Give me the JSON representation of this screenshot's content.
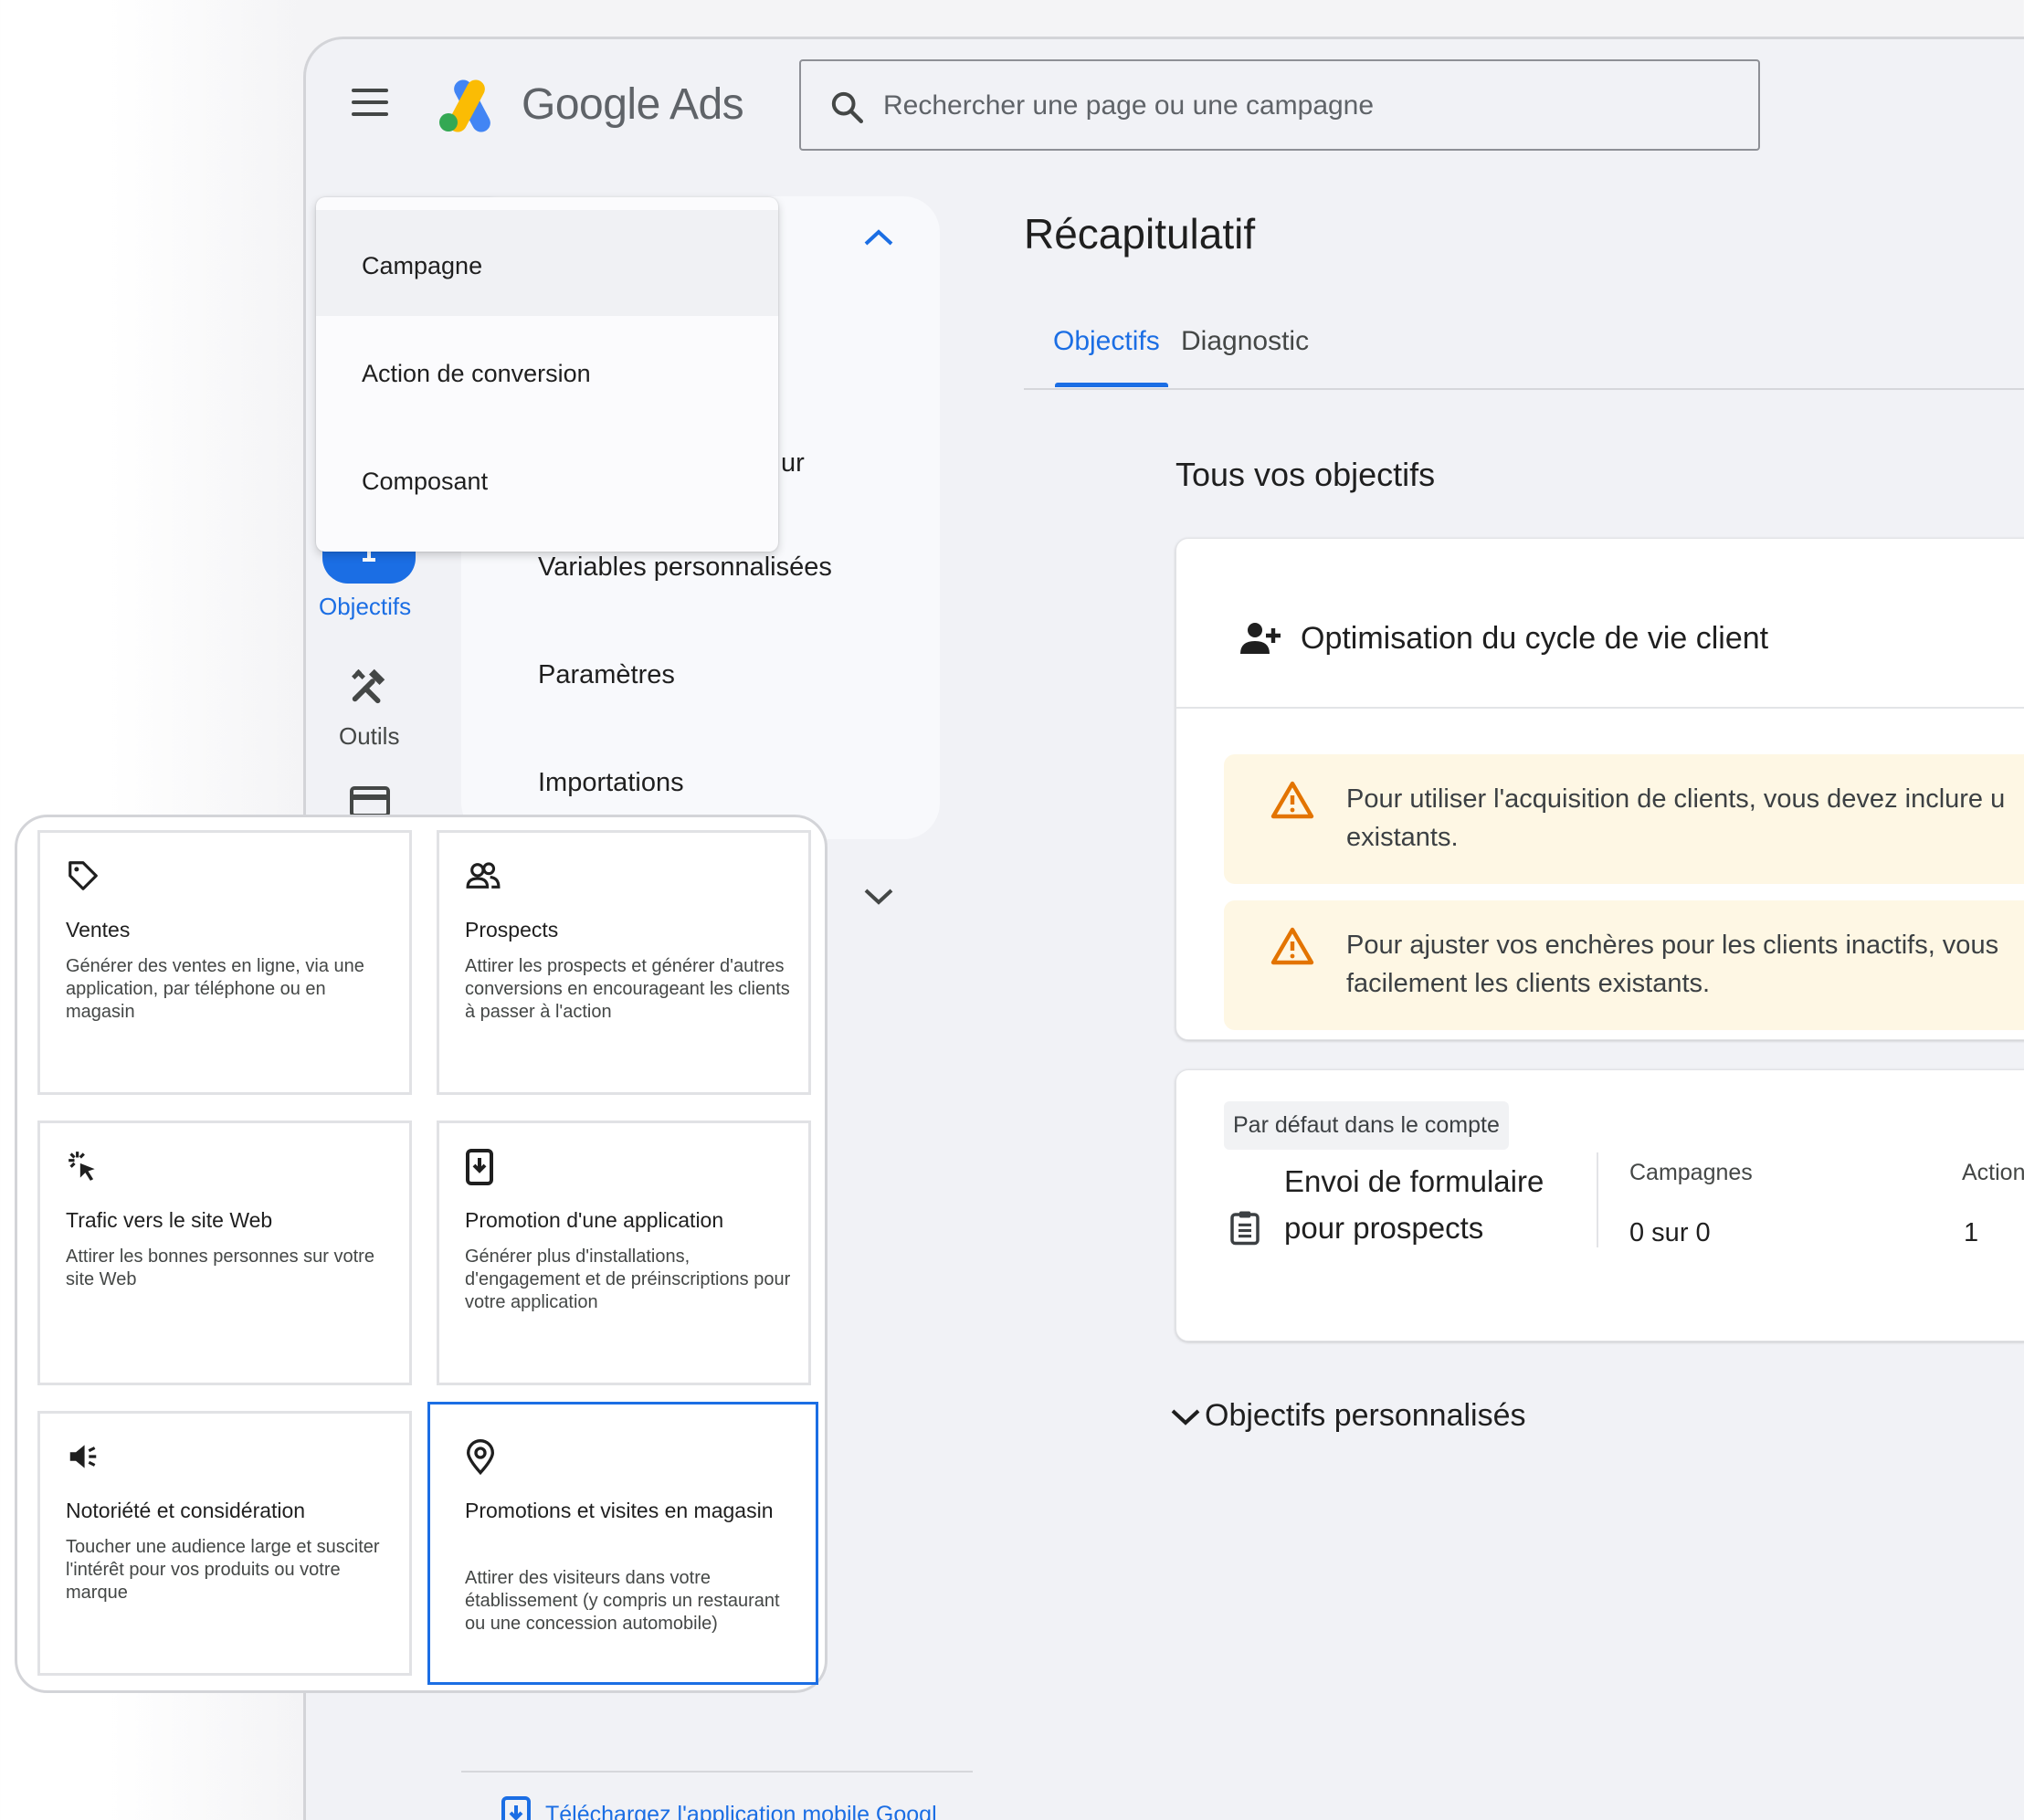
{
  "header": {
    "brand": "Google Ads",
    "search_placeholder": "Rechercher une page ou une campagne"
  },
  "create_menu": {
    "items": [
      {
        "label": "Campagne"
      },
      {
        "label": "Action de conversion"
      },
      {
        "label": "Composant"
      }
    ]
  },
  "nav": {
    "partial_label": "ur",
    "links": [
      {
        "label": "Variables personnalisées"
      },
      {
        "label": "Paramètres"
      },
      {
        "label": "Importations"
      }
    ]
  },
  "rail": {
    "goals_label": "Objectifs",
    "tools_label": "Outils"
  },
  "main": {
    "title": "Récapitulatif",
    "tabs": [
      {
        "label": "Objectifs",
        "active": true
      },
      {
        "label": "Diagnostic",
        "active": false
      }
    ],
    "section_heading": "Tous vos objectifs",
    "lifecycle": {
      "title": "Optimisation du cycle de vie client",
      "warnings": [
        {
          "line1": "Pour utiliser l'acquisition de clients, vous devez inclure u",
          "line2": "existants."
        },
        {
          "line1": "Pour ajuster vos enchères pour les clients inactifs, vous",
          "line2": "facilement les clients existants."
        }
      ]
    },
    "default_goal": {
      "chip": "Par défaut dans le compte",
      "name": "Envoi de formulaire pour prospects",
      "campaigns_header": "Campagnes",
      "campaigns_value": "0 sur 0",
      "actions_header": "Action",
      "actions_value": "1"
    },
    "custom_goals": "Objectifs personnalisés"
  },
  "footer": {
    "link": "Téléchargez l'application mobile Googl"
  },
  "goal_categories": [
    {
      "icon": "tag-icon",
      "title": "Ventes",
      "desc": "Générer des ventes en ligne, via une application, par téléphone ou en magasin"
    },
    {
      "icon": "people-icon",
      "title": "Prospects",
      "desc": "Attirer les prospects et générer d'autres conversions en encourageant les clients à passer à l'action"
    },
    {
      "icon": "cursor-click-icon",
      "title": "Trafic vers le site Web",
      "desc": "Attirer les bonnes personnes sur votre site Web"
    },
    {
      "icon": "phone-download-icon",
      "title": "Promotion d'une application",
      "desc": "Générer plus d'installations, d'engagement et de préinscriptions pour votre application"
    },
    {
      "icon": "megaphone-icon",
      "title": "Notoriété et considération",
      "desc": "Toucher une audience large et susciter l'intérêt pour vos produits ou votre marque"
    },
    {
      "icon": "location-pin-icon",
      "title": "Promotions et visites en magasin",
      "desc": "Attirer des visiteurs dans votre établissement (y compris un restaurant ou une concession automobile)",
      "selected": true
    }
  ],
  "colors": {
    "accent": "#1b6ee4",
    "warning_bg": "#fef7e4",
    "warning_icon": "#e37400",
    "logo_yellow": "#fbbc04",
    "logo_blue": "#4285f4",
    "logo_green": "#34a853"
  }
}
